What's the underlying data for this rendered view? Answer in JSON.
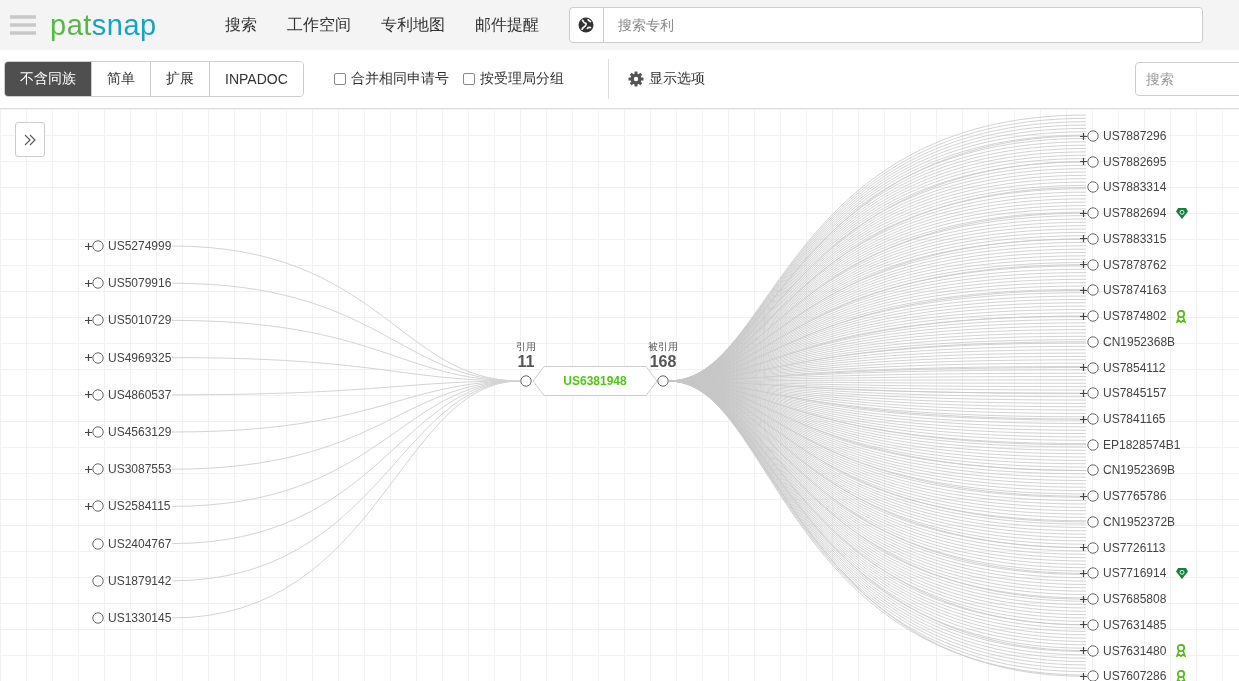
{
  "header": {
    "logo": {
      "part_1": "pat",
      "part_2": "snap"
    },
    "nav": [
      "搜索",
      "工作空间",
      "专利地图",
      "邮件提醒"
    ],
    "search": {
      "placeholder": "搜索专利"
    }
  },
  "toolbar": {
    "view_modes": [
      {
        "label": "不含同族",
        "selected": true
      },
      {
        "label": "简单",
        "selected": false
      },
      {
        "label": "扩展",
        "selected": false
      },
      {
        "label": "INPADOC",
        "selected": false
      }
    ],
    "options": [
      {
        "label": "合并相同申请号",
        "checked": false
      },
      {
        "label": "按受理局分组",
        "checked": false
      }
    ],
    "display_options": "显示选项",
    "search": {
      "placeholder": "搜索"
    }
  },
  "graph": {
    "center": {
      "patent": "US6381948",
      "cites_label": "引用",
      "cites_count": "11",
      "cited_label": "被引用",
      "cited_count": "168"
    },
    "left_nodes": [
      {
        "patent": "US5274999",
        "expandable": true
      },
      {
        "patent": "US5079916",
        "expandable": true
      },
      {
        "patent": "US5010729",
        "expandable": true
      },
      {
        "patent": "US4969325",
        "expandable": true
      },
      {
        "patent": "US4860537",
        "expandable": true
      },
      {
        "patent": "US4563129",
        "expandable": true
      },
      {
        "patent": "US3087553",
        "expandable": true
      },
      {
        "patent": "US2584115",
        "expandable": true
      },
      {
        "patent": "US2404767",
        "expandable": false
      },
      {
        "patent": "US1879142",
        "expandable": false
      },
      {
        "patent": "US1330145",
        "expandable": false
      }
    ],
    "right_nodes": [
      {
        "patent": "US7887296",
        "expandable": true,
        "kind": "plain"
      },
      {
        "patent": "US7882695",
        "expandable": true,
        "kind": "plain"
      },
      {
        "patent": "US7883314",
        "expandable": false,
        "kind": "plain"
      },
      {
        "patent": "US7882694",
        "expandable": true,
        "kind": "gem"
      },
      {
        "patent": "US7883315",
        "expandable": true,
        "kind": "plain"
      },
      {
        "patent": "US7878762",
        "expandable": true,
        "kind": "plain"
      },
      {
        "patent": "US7874163",
        "expandable": true,
        "kind": "plain"
      },
      {
        "patent": "US7874802",
        "expandable": true,
        "kind": "ribbon"
      },
      {
        "patent": "CN1952368B",
        "expandable": false,
        "kind": "plain"
      },
      {
        "patent": "US7854112",
        "expandable": true,
        "kind": "plain"
      },
      {
        "patent": "US7845157",
        "expandable": true,
        "kind": "plain"
      },
      {
        "patent": "US7841165",
        "expandable": true,
        "kind": "plain"
      },
      {
        "patent": "EP1828574B1",
        "expandable": false,
        "kind": "plain"
      },
      {
        "patent": "CN1952369B",
        "expandable": false,
        "kind": "plain"
      },
      {
        "patent": "US7765786",
        "expandable": true,
        "kind": "plain"
      },
      {
        "patent": "CN1952372B",
        "expandable": false,
        "kind": "plain"
      },
      {
        "patent": "US7726113",
        "expandable": true,
        "kind": "plain"
      },
      {
        "patent": "US7716914",
        "expandable": true,
        "kind": "gem"
      },
      {
        "patent": "US7685808",
        "expandable": true,
        "kind": "plain"
      },
      {
        "patent": "US7631485",
        "expandable": true,
        "kind": "plain"
      },
      {
        "patent": "US7631480",
        "expandable": true,
        "kind": "ribbon"
      },
      {
        "patent": "US7607286",
        "expandable": true,
        "kind": "ribbon"
      }
    ]
  }
}
